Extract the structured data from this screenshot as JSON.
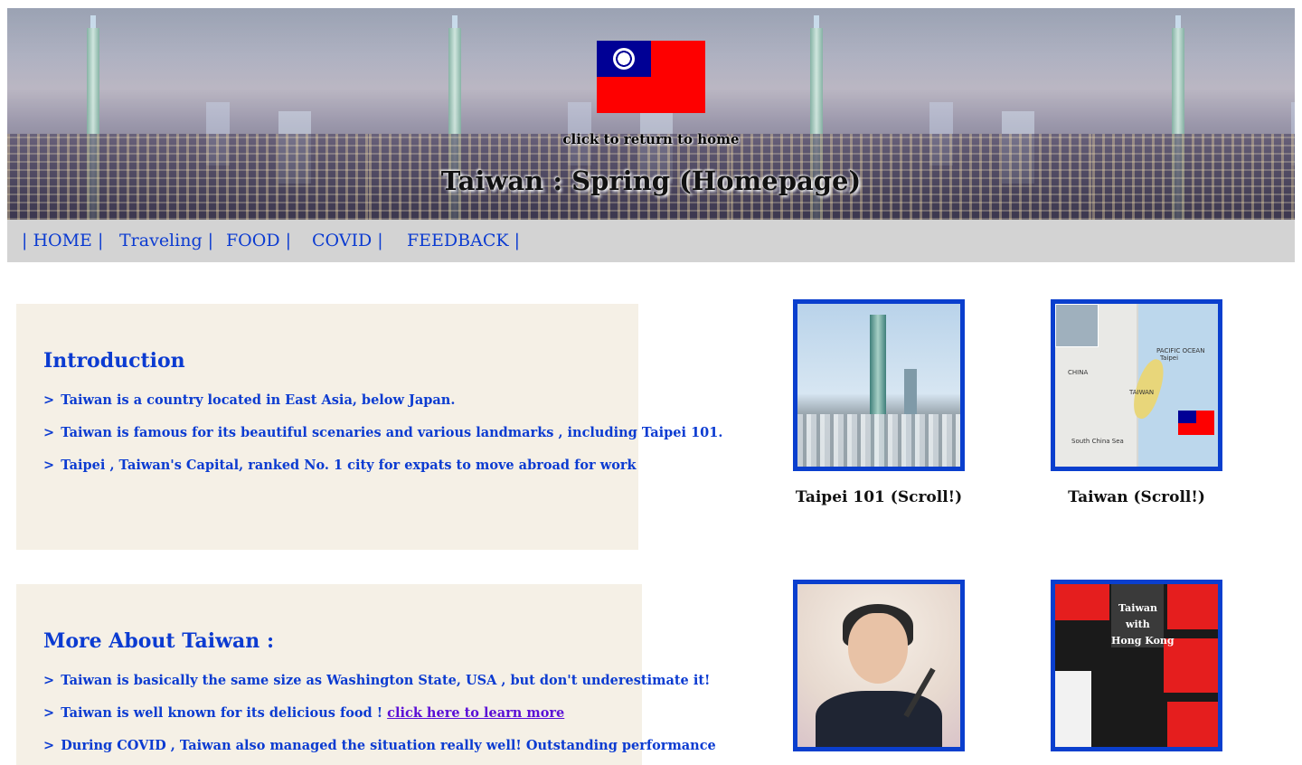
{
  "header": {
    "return_text": "click to return to home",
    "title": "Taiwan : Spring (Homepage)",
    "flag_icon": "taiwan-flag-icon"
  },
  "nav": {
    "items": [
      {
        "label": "| HOME |"
      },
      {
        "label": "Traveling |"
      },
      {
        "label": "FOOD |"
      },
      {
        "label": "COVID |"
      },
      {
        "label": "FEEDBACK |"
      }
    ]
  },
  "intro": {
    "heading": "Introduction",
    "lines": [
      "Taiwan is a country located in East Asia, below Japan.",
      "Taiwan is famous for its beautiful scenaries and various landmarks , including Taipei 101.",
      "Taipei , Taiwan's Capital, ranked No. 1 city for expats to move abroad for work"
    ]
  },
  "more": {
    "heading": "More About Taiwan :",
    "line1": "Taiwan is basically the same size as Washington State, USA , but don't underestimate it!",
    "line2_text": "Taiwan is well known for its delicious food ! ",
    "line2_link": "click here to learn more",
    "line3": "During COVID , Taiwan also managed the situation really well! Outstanding performance"
  },
  "arrow": ">",
  "gallery": {
    "card1_caption": "Taipei 101 (Scroll!)",
    "card2_caption": "Taiwan (Scroll!)",
    "map_labels": {
      "pacific": "PACIFIC OCEAN",
      "china": "CHINA",
      "taipei": "Taipei",
      "taiwan": "TAIWAN",
      "sea": "South China Sea"
    },
    "protest_labels": {
      "l1": "Taiwan",
      "l2": "with",
      "l3": "Hong Kong"
    }
  },
  "colors": {
    "nav_bg": "#d3d3d3",
    "box_bg": "#f5f0e6",
    "text_blue": "#0b3bd1",
    "card_border": "#0a3fce",
    "link_purple": "#5a0fd6"
  }
}
